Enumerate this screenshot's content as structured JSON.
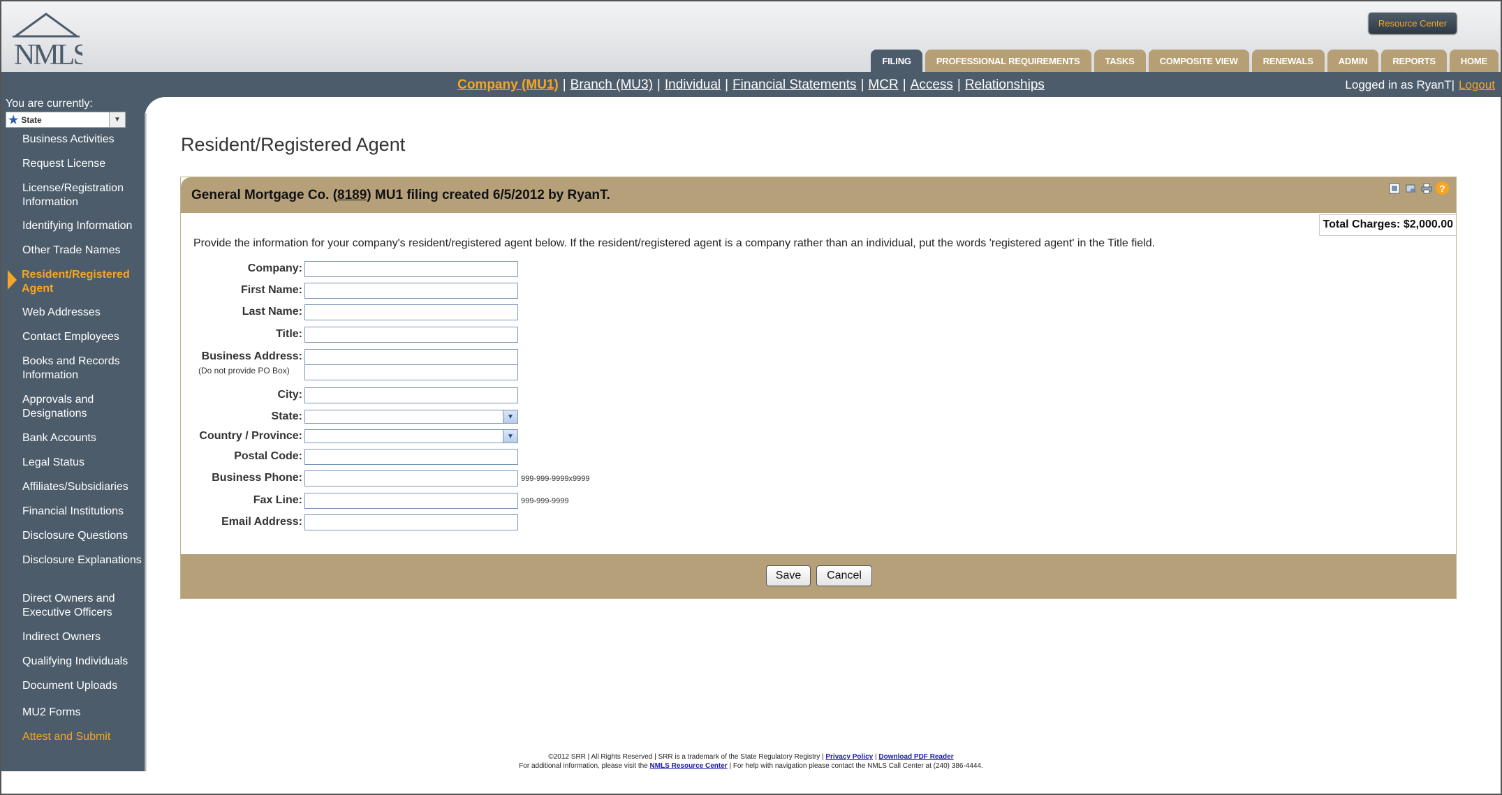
{
  "header": {
    "resource_center": "Resource Center",
    "tabs": [
      "FILING",
      "PROFESSIONAL REQUIREMENTS",
      "TASKS",
      "COMPOSITE VIEW",
      "RENEWALS",
      "ADMIN",
      "REPORTS",
      "HOME"
    ]
  },
  "subnav": {
    "links": [
      "Company (MU1)",
      "Branch (MU3)",
      "Individual",
      "Financial Statements",
      "MCR",
      "Access",
      "Relationships"
    ],
    "separator": "|",
    "logged_in": "Logged in as RyanT",
    "logout": "Logout"
  },
  "sidebar": {
    "you_are": "You are currently:",
    "state_value": "State",
    "items": [
      "Business Activities",
      "Request License",
      "License/Registration Information",
      "Identifying Information",
      "Other Trade Names",
      "Resident/Registered Agent",
      "Web Addresses",
      "Contact Employees",
      "Books and Records Information",
      "Approvals and Designations",
      "Bank Accounts",
      "Legal Status",
      "Affiliates/Subsidiaries",
      "Financial Institutions",
      "Disclosure Questions",
      "Disclosure Explanations",
      "Direct Owners and Executive Officers",
      "Indirect Owners",
      "Qualifying Individuals",
      "Document Uploads",
      "MU2 Forms",
      "Attest and Submit"
    ]
  },
  "main": {
    "title": "Resident/Registered Agent",
    "panel": {
      "title_pre": "General Mortgage Co. (",
      "title_id": "8189",
      "title_post": ") MU1 filing created 6/5/2012 by RyanT.",
      "total_charges": "Total Charges: $2,000.00",
      "intro": "Provide the information for your company's resident/registered agent below. If the resident/registered agent is a company rather than an individual, put the words 'registered agent' in the Title field.",
      "labels": {
        "company": "Company:",
        "first_name": "First Name:",
        "last_name": "Last Name:",
        "title": "Title:",
        "business_address": "Business Address:",
        "po_box_note": "(Do not provide PO Box)",
        "city": "City:",
        "state": "State:",
        "country": "Country / Province:",
        "postal_code": "Postal Code:",
        "business_phone": "Business Phone:",
        "fax_line": "Fax Line:",
        "email": "Email Address:"
      },
      "hints": {
        "phone": "999-999-9999x9999",
        "fax": "999-999-9999"
      },
      "save": "Save",
      "cancel": "Cancel"
    }
  },
  "footer": {
    "line1_pre": "©2012 SRR | All Rights Reserved | SRR is a trademark of the State Regulatory Registry |",
    "privacy": "Privacy Policy",
    "download": "Download PDF Reader",
    "line2_pre": "For additional information, please visit the",
    "nmls_resource": "NMLS Resource Center",
    "line2_post": "| For help with navigation please contact the NMLS Call Center at (240) 386-4444."
  }
}
